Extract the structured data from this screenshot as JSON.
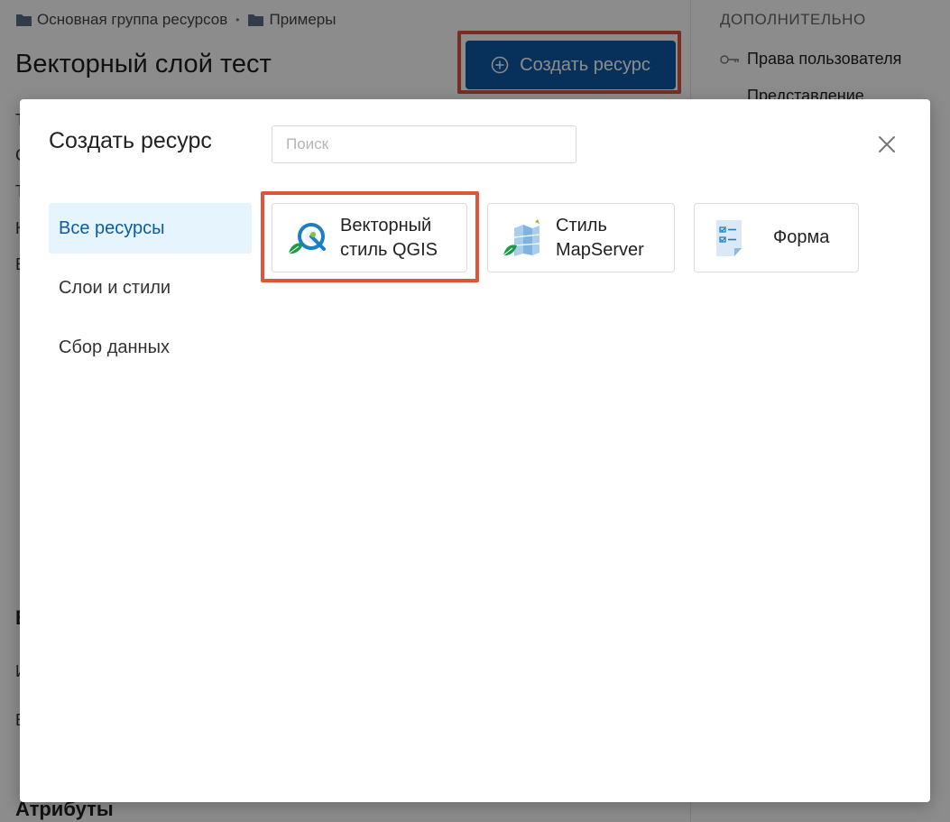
{
  "breadcrumb": {
    "items": [
      "Основная группа ресурсов",
      "Примеры"
    ],
    "separator": "•"
  },
  "page": {
    "title": "Векторный слой тест",
    "create_button_label": "Создать ресурс",
    "partial_letters": [
      "Т",
      "С",
      "Т",
      "К",
      "В"
    ],
    "partial_bold_letter": "В",
    "partial_lower_letters": [
      "И",
      "В"
    ],
    "attributes_heading": "Атрибуты"
  },
  "sidebar": {
    "heading": "ДОПОЛНИТЕЛЬНО",
    "links": [
      "Права пользователя",
      "Представление"
    ]
  },
  "modal": {
    "title": "Создать ресурс",
    "search_placeholder": "Поиск",
    "categories": [
      {
        "label": "Все ресурсы",
        "active": true
      },
      {
        "label": "Слои и стили",
        "active": false
      },
      {
        "label": "Сбор данных",
        "active": false
      }
    ],
    "tiles": [
      {
        "label": "Векторный\nстиль QGIS",
        "icon": "qgis-style-icon"
      },
      {
        "label": "Стиль\nMapServer",
        "icon": "mapserver-style-icon"
      },
      {
        "label": "Форма",
        "icon": "form-icon"
      }
    ]
  },
  "colors": {
    "primary": "#0e5aa7",
    "highlight": "#e0533d",
    "active_bg": "#e6f4fd"
  }
}
